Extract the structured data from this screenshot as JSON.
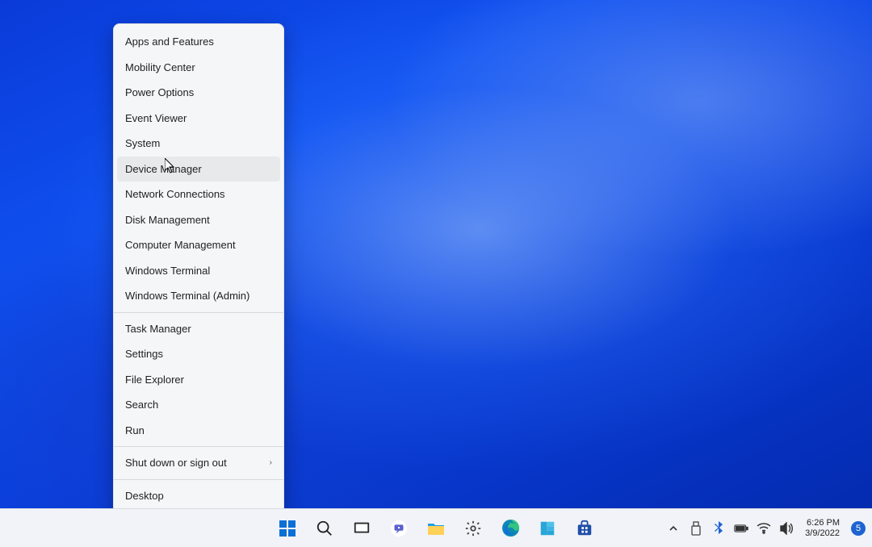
{
  "menu": {
    "groups": [
      [
        "Apps and Features",
        "Mobility Center",
        "Power Options",
        "Event Viewer",
        "System",
        "Device Manager",
        "Network Connections",
        "Disk Management",
        "Computer Management",
        "Windows Terminal",
        "Windows Terminal (Admin)"
      ],
      [
        "Task Manager",
        "Settings",
        "File Explorer",
        "Search",
        "Run"
      ],
      [
        "Shut down or sign out"
      ],
      [
        "Desktop"
      ]
    ],
    "hovered": "Device Manager",
    "submenu_indicator": "›"
  },
  "taskbar": {
    "icons": [
      "start",
      "search",
      "task-view",
      "chat",
      "file-explorer",
      "settings",
      "edge",
      "microsoft-teams",
      "microsoft-store"
    ]
  },
  "tray": {
    "icons": [
      "overflow",
      "usb",
      "bluetooth",
      "battery",
      "wifi",
      "volume"
    ],
    "time": "6:26 PM",
    "date": "3/9/2022",
    "badge": "5"
  }
}
